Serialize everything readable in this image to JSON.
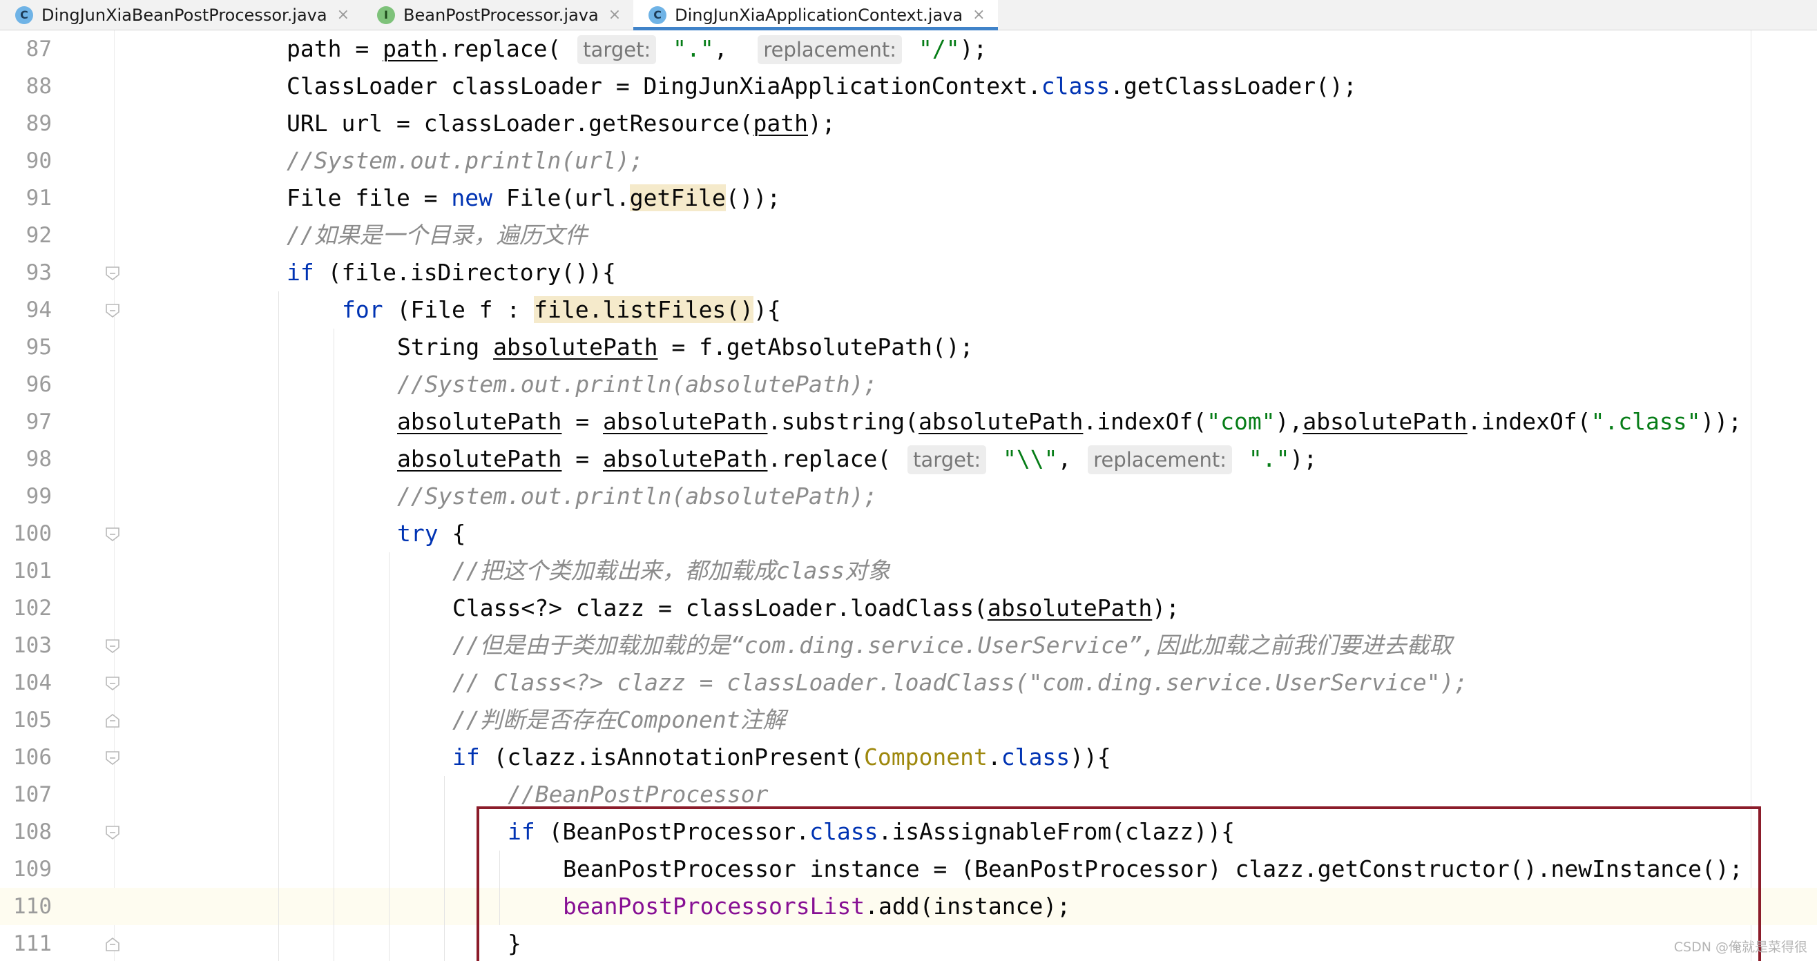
{
  "tabs": [
    {
      "label": "DingJunXiaBeanPostProcessor.java",
      "icon": "class-icon",
      "icon_letter": "C",
      "active": false
    },
    {
      "label": "BeanPostProcessor.java",
      "icon": "interface-icon",
      "icon_letter": "I",
      "active": false
    },
    {
      "label": "DingJunXiaApplicationContext.java",
      "icon": "class-icon",
      "icon_letter": "C",
      "active": true
    }
  ],
  "tab_close_glyph": "×",
  "editor": {
    "current_line": "110",
    "lines": [
      {
        "n": "87",
        "segs": [
          [
            "",
            "path"
          ],
          [
            " = "
          ],
          [
            "ul",
            "path"
          ],
          [
            ".replace( "
          ],
          [
            "hint",
            "target:"
          ],
          [
            " "
          ],
          [
            "str",
            "\".\""
          ],
          [
            ",  "
          ],
          [
            "hint",
            "replacement:"
          ],
          [
            " "
          ],
          [
            "str",
            "\"/\""
          ],
          [
            ");"
          ]
        ]
      },
      {
        "n": "88",
        "segs": [
          [
            "",
            "ClassLoader classLoader = DingJunXiaApplicationContext."
          ],
          [
            "kw",
            "class"
          ],
          [
            "",
            ".getClassLoader();"
          ]
        ]
      },
      {
        "n": "89",
        "segs": [
          [
            "",
            "URL url = classLoader.getResource("
          ],
          [
            "ul",
            "path"
          ],
          [
            "",
            ");"
          ]
        ]
      },
      {
        "n": "90",
        "segs": [
          [
            "cm",
            "//System.out.println(url);"
          ]
        ]
      },
      {
        "n": "91",
        "segs": [
          [
            "",
            "File file = "
          ],
          [
            "kw",
            "new"
          ],
          [
            "",
            " File(url."
          ],
          [
            "hl",
            "getFile"
          ],
          [
            "",
            "());"
          ]
        ]
      },
      {
        "n": "92",
        "segs": [
          [
            "cm",
            "//如果是一个目录，遍历文件"
          ]
        ]
      },
      {
        "n": "93",
        "segs": [
          [
            "kw",
            "if"
          ],
          [
            "",
            " (file.isDirectory()){"
          ]
        ]
      },
      {
        "n": "94",
        "segs": [
          [
            "kw",
            "for"
          ],
          [
            "",
            " (File f : "
          ],
          [
            "hl",
            "file.listFiles()"
          ],
          [
            "",
            "){"
          ]
        ]
      },
      {
        "n": "95",
        "segs": [
          [
            "",
            "String "
          ],
          [
            "ul",
            "absolutePath"
          ],
          [
            "",
            " = f.getAbsolutePath();"
          ]
        ]
      },
      {
        "n": "96",
        "segs": [
          [
            "cm",
            "//System.out.println(absolutePath);"
          ]
        ]
      },
      {
        "n": "97",
        "segs": [
          [
            "ul",
            "absolutePath"
          ],
          [
            "",
            " = "
          ],
          [
            "ul",
            "absolutePath"
          ],
          [
            "",
            ".substring("
          ],
          [
            "ul",
            "absolutePath"
          ],
          [
            "",
            ".indexOf("
          ],
          [
            "str",
            "\"com\""
          ],
          [
            "",
            "),"
          ],
          [
            "ul",
            "absolutePath"
          ],
          [
            "",
            ".indexOf("
          ],
          [
            "str",
            "\".class\""
          ],
          [
            "",
            "));"
          ]
        ]
      },
      {
        "n": "98",
        "segs": [
          [
            "ul",
            "absolutePath"
          ],
          [
            "",
            " = "
          ],
          [
            "ul",
            "absolutePath"
          ],
          [
            "",
            ".replace( "
          ],
          [
            "hint",
            "target:"
          ],
          [
            "",
            " "
          ],
          [
            "str",
            "\"\\\\\""
          ],
          [
            "",
            ", "
          ],
          [
            "hint",
            "replacement:"
          ],
          [
            "",
            " "
          ],
          [
            "str",
            "\".\""
          ],
          [
            "",
            ");"
          ]
        ]
      },
      {
        "n": "99",
        "segs": [
          [
            "cm",
            "//System.out.println(absolutePath);"
          ]
        ]
      },
      {
        "n": "100",
        "segs": [
          [
            "kw",
            "try"
          ],
          [
            "",
            " {"
          ]
        ]
      },
      {
        "n": "101",
        "segs": [
          [
            "cm",
            "//把这个类加载出来，都加载成class对象"
          ]
        ]
      },
      {
        "n": "102",
        "segs": [
          [
            "",
            "Class<?> clazz = classLoader.loadClass("
          ],
          [
            "ul",
            "absolutePath"
          ],
          [
            "",
            ");"
          ]
        ]
      },
      {
        "n": "103",
        "segs": [
          [
            "cm",
            "//但是由于类加载加载的是“com.ding.service.UserService”,因此加载之前我们要进去截取"
          ]
        ]
      },
      {
        "n": "104",
        "segs": [
          [
            "cm",
            "// Class<?> clazz = classLoader.loadClass(\"com.ding.service.UserService\");"
          ]
        ]
      },
      {
        "n": "105",
        "segs": [
          [
            "cm",
            "//判断是否存在Component注解"
          ]
        ]
      },
      {
        "n": "106",
        "segs": [
          [
            "kw",
            "if"
          ],
          [
            "",
            " (clazz.isAnnotationPresent("
          ],
          [
            "ann",
            "Component"
          ],
          [
            "",
            "."
          ],
          [
            "kw",
            "class"
          ],
          [
            "",
            ")){"
          ]
        ]
      },
      {
        "n": "107",
        "segs": [
          [
            "cm",
            "//BeanPostProcessor"
          ]
        ]
      },
      {
        "n": "108",
        "segs": [
          [
            "kw",
            "if"
          ],
          [
            "",
            " (BeanPostProcessor."
          ],
          [
            "kw",
            "class"
          ],
          [
            "",
            ".isAssignableFrom(clazz)){"
          ]
        ]
      },
      {
        "n": "109",
        "segs": [
          [
            "",
            "BeanPostProcessor instance = (BeanPostProcessor) clazz.getConstructor().newInstance();"
          ]
        ]
      },
      {
        "n": "110",
        "segs": [
          [
            "fld",
            "beanPostProcessorsList"
          ],
          [
            "",
            ".add(instance);"
          ]
        ]
      },
      {
        "n": "111",
        "segs": [
          [
            "",
            "}"
          ]
        ]
      }
    ]
  },
  "watermark": "CSDN @俺就是菜得很",
  "colors": {
    "keyword": "#0033b3",
    "comment": "#8c8c8c",
    "string": "#067d17",
    "field": "#871094",
    "annotation": "#9e880d",
    "callout_border": "#8b1c2a",
    "active_tab_underline": "#4083c9"
  }
}
